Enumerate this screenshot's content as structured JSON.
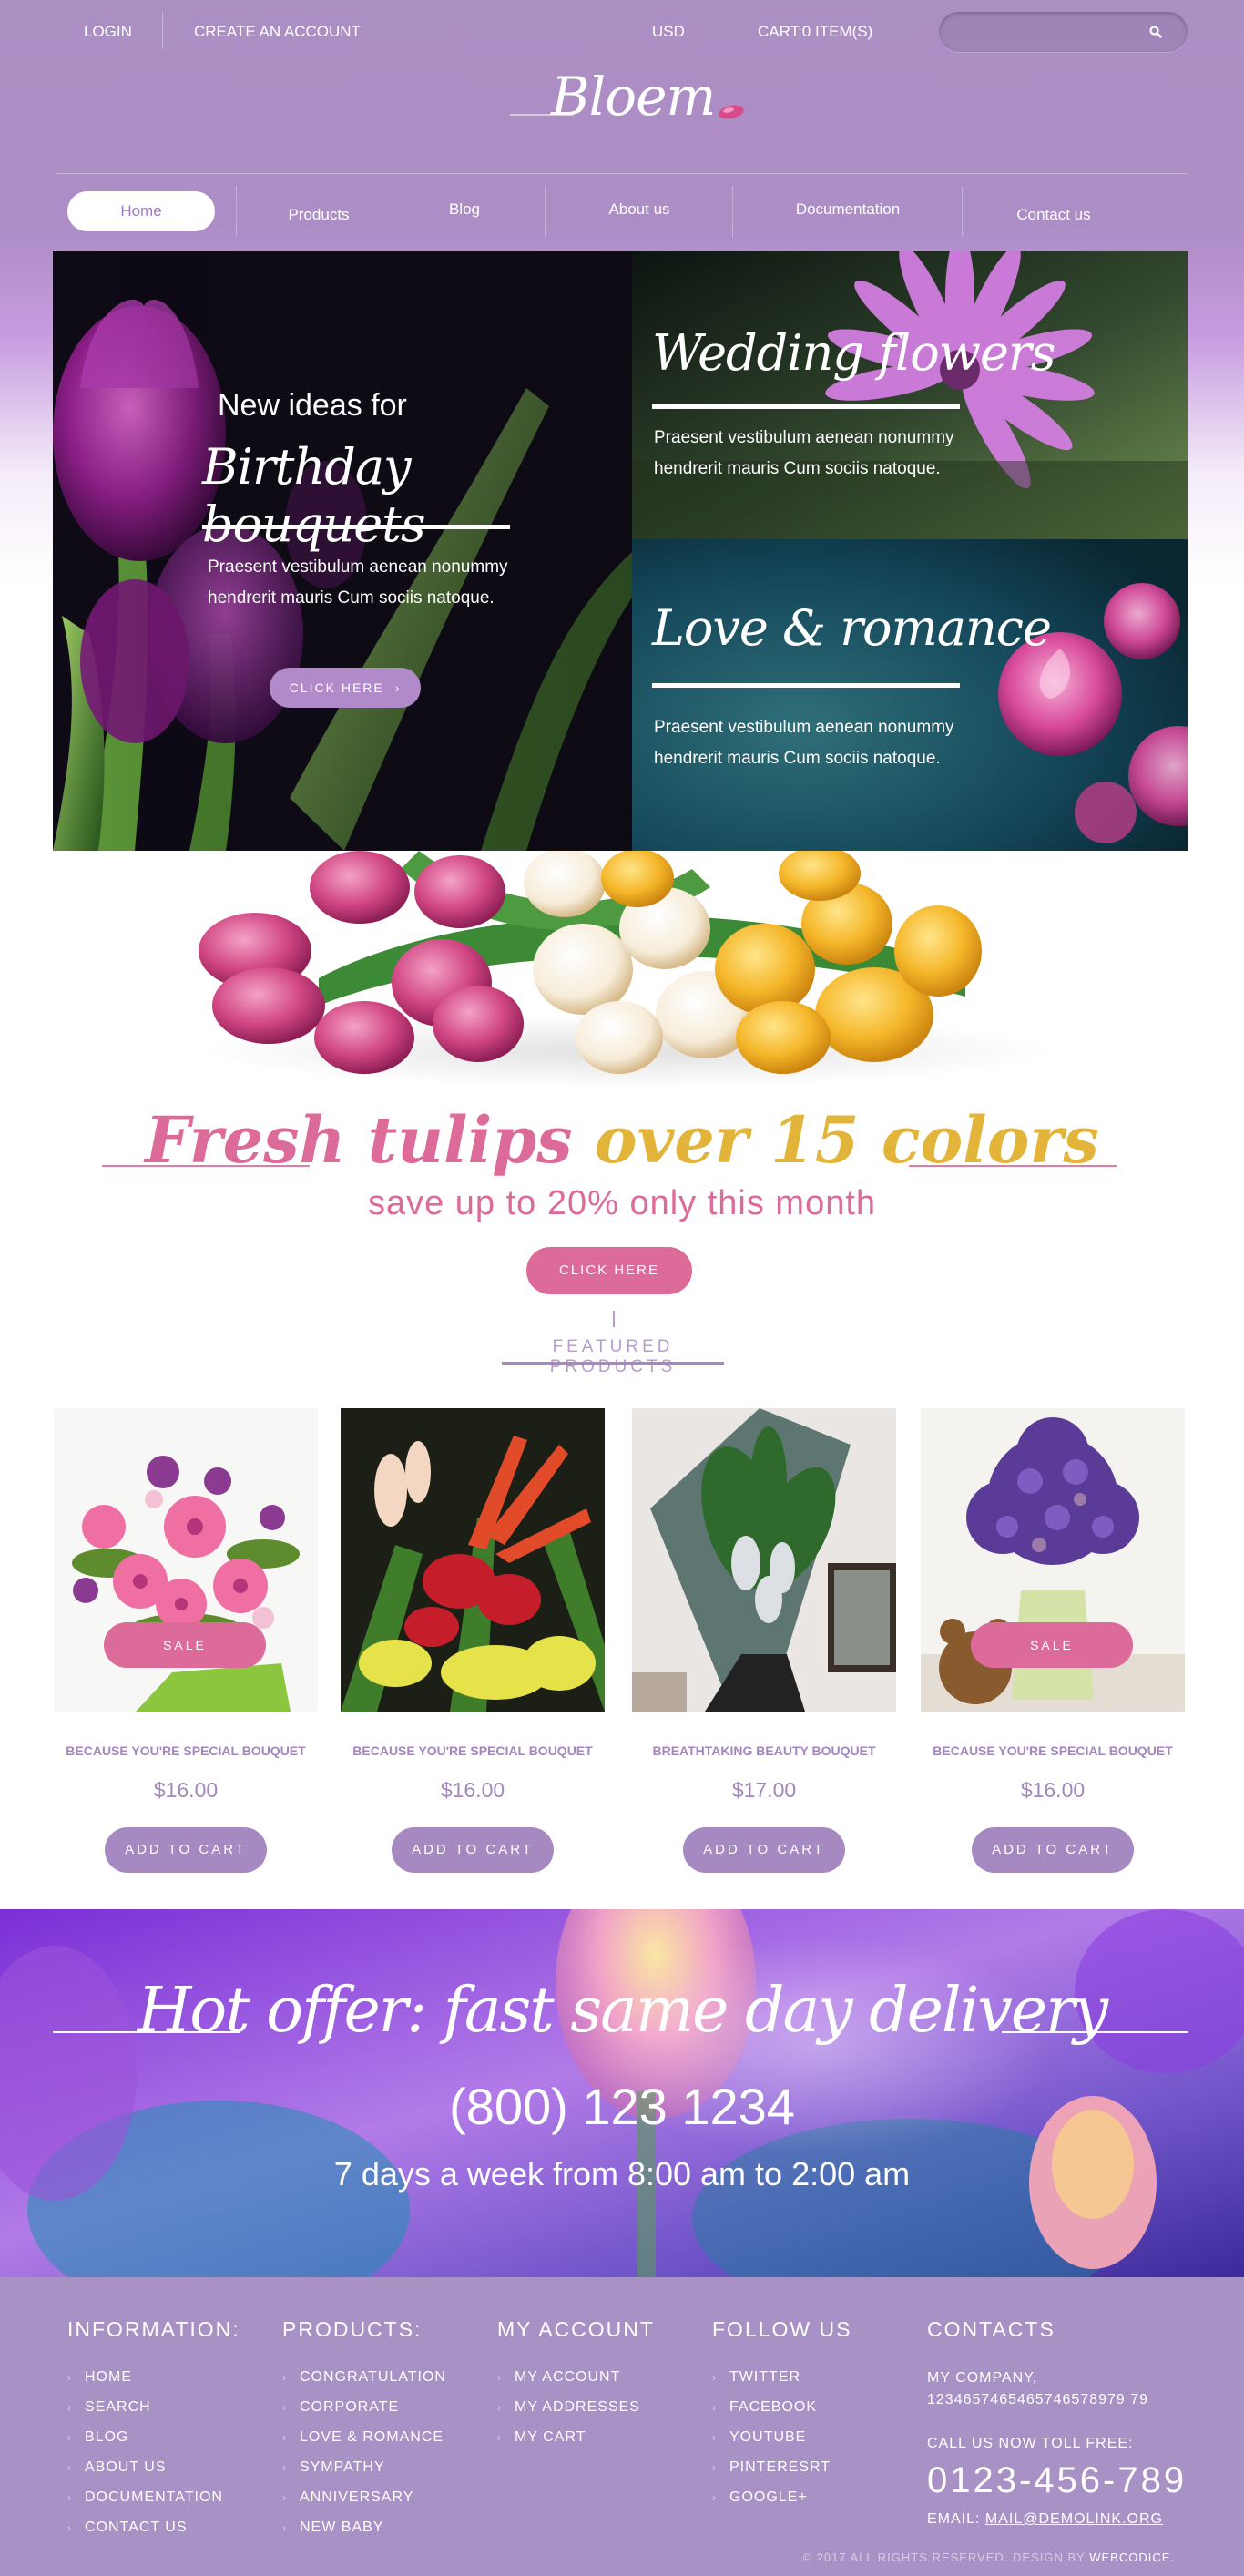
{
  "topbar": {
    "login": "LOGIN",
    "create_account": "CREATE AN ACCOUNT",
    "currency": "USD",
    "cart": "CART:0  ITEM(S)",
    "search_placeholder": ""
  },
  "logo": {
    "text": "Bloem"
  },
  "nav": {
    "items": [
      {
        "label": "Home",
        "active": true
      },
      {
        "label": "Products"
      },
      {
        "label": "Blog"
      },
      {
        "label": "About us"
      },
      {
        "label": "Documentation"
      },
      {
        "label": "Contact us"
      }
    ]
  },
  "banners": {
    "birthday": {
      "small": "New ideas for",
      "script": "Birthday  bouquets",
      "desc": "Praesent vestibulum aenean nonummy hendrerit mauris Cum sociis natoque.",
      "button": "CLICK HERE"
    },
    "wedding": {
      "script": "Wedding flowers",
      "desc": "Praesent vestibulum aenean nonummy hendrerit mauris Cum sociis natoque."
    },
    "love": {
      "script": "Love & romance",
      "desc": "Praesent vestibulum aenean nonummy hendrerit mauris Cum sociis natoque."
    }
  },
  "promo": {
    "title_pink": "Fresh tulips",
    "title_gold": " over 15 colors",
    "subtitle": "save up to 20% only this month",
    "button": "CLICK HERE"
  },
  "featured": {
    "title": "FEATURED PRODUCTS"
  },
  "products": [
    {
      "name": "BECAUSE YOU'RE SPECIAL BOUQUET",
      "price": "$16.00",
      "button": "ADD TO CART",
      "badge": "SALE"
    },
    {
      "name": "BECAUSE YOU'RE SPECIAL BOUQUET",
      "price": "$16.00",
      "button": "ADD TO CART"
    },
    {
      "name": "BREATHTAKING BEAUTY BOUQUET",
      "price": "$17.00",
      "button": "ADD TO CART"
    },
    {
      "name": "BECAUSE YOU'RE SPECIAL BOUQUET",
      "price": "$16.00",
      "button": "ADD TO CART",
      "badge": "SALE"
    }
  ],
  "hot_offer": {
    "title": "Hot offer:  fast same day delivery",
    "phone": "(800) 123 1234",
    "hours": "7 days a week from 8:00 am to 2:00 am"
  },
  "footer": {
    "information": {
      "heading": "INFORMATION:",
      "links": [
        "HOME",
        "SEARCH",
        "BLOG",
        "ABOUT US",
        "DOCUMENTATION",
        "CONTACT US"
      ]
    },
    "products": {
      "heading": "PRODUCTS:",
      "links": [
        "CONGRATULATION",
        "CORPORATE",
        "LOVE & ROMANCE",
        "SYMPATHY",
        "ANNIVERSARY",
        "NEW BABY"
      ]
    },
    "account": {
      "heading": "MY ACCOUNT",
      "links": [
        "MY ACCOUNT",
        "MY ADDRESSES",
        "MY CART"
      ]
    },
    "follow": {
      "heading": "FOLLOW US",
      "links": [
        "TWITTER",
        "FACEBOOK",
        "YOUTUBE",
        "PINTERESRT",
        "GOOGLE+"
      ]
    },
    "contacts": {
      "heading": "CONTACTS",
      "company": "MY COMPANY,",
      "company_number": "1234657465465746578979 79",
      "toll_free_label": "CALL US NOW TOLL FREE:",
      "phone": "0123-456-789",
      "email_label": "EMAIL:",
      "email": "MAIL@DEMOLINK.ORG"
    },
    "copyright": "© 2017 ALL RIGHTS RESERVED. DESIGN BY",
    "designer": "WEBCODICE."
  },
  "colors": {
    "header_purple": "#ab8fc2",
    "accent_pink": "#dc6b9a",
    "accent_gold": "#e2b43a",
    "button_purple": "#a689c0",
    "footer_purple": "#a891c4"
  }
}
